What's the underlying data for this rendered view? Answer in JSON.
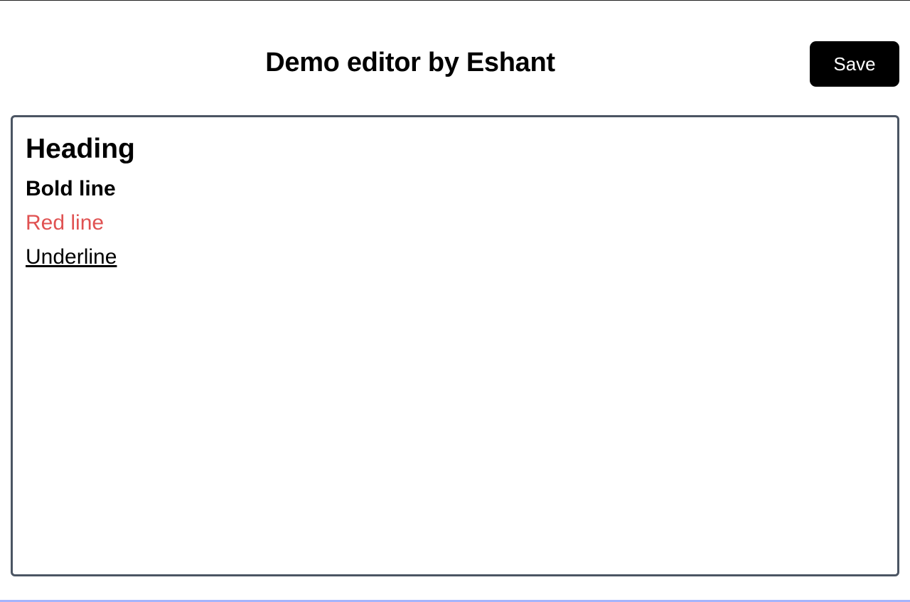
{
  "header": {
    "title": "Demo editor by Eshant",
    "save_label": "Save"
  },
  "editor": {
    "lines": [
      {
        "text": "Heading",
        "style": "heading"
      },
      {
        "text": "Bold line",
        "style": "bold"
      },
      {
        "text": "Red line",
        "style": "red",
        "color": "#e05252"
      },
      {
        "text": "Underline",
        "style": "underline"
      }
    ],
    "border_color": "#4b5563"
  }
}
